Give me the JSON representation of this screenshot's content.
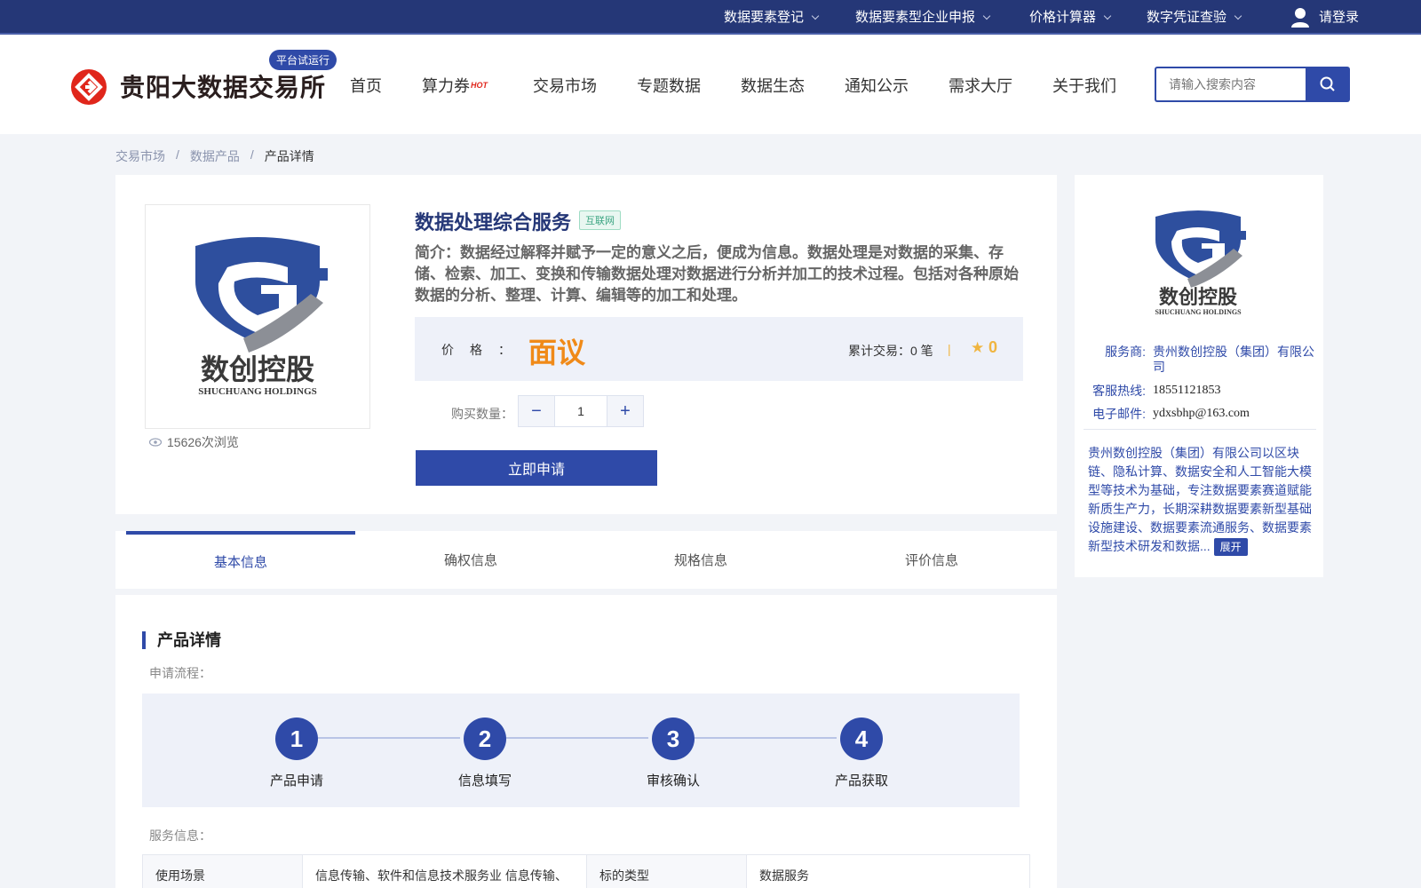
{
  "topbar": {
    "items": [
      "数据要素登记",
      "数据要素型企业申报",
      "价格计算器",
      "数字凭证查验"
    ],
    "login_label": "请登录"
  },
  "header": {
    "logo_text": "贵阳大数据交易所",
    "trial_badge": "平台试运行",
    "nav": [
      "首页",
      "算力券",
      "交易市场",
      "专题数据",
      "数据生态",
      "通知公示",
      "需求大厅",
      "关于我们"
    ],
    "hot_label": "HOT",
    "search_placeholder": "请输入搜索内容"
  },
  "breadcrumb": {
    "items": [
      "交易市场",
      "数据产品",
      "产品详情"
    ],
    "separator": "/"
  },
  "product": {
    "title": "数据处理综合服务",
    "tag": "互联网",
    "intro": "简介：数据经过解释并赋予一定的意义之后，便成为信息。数据处理是对数据的采集、存储、检索、加工、变换和传输数据处理对数据进行分析并加工的技术过程。包括对各种原始数据的分析、整理、计算、编辑等的加工和处理。",
    "logo_cn": "数创控股",
    "logo_en": "SHUCHUANG HOLDINGS",
    "views": "15626次浏览",
    "price_label": "价格：",
    "price_value": "面议",
    "trade_text": "累计交易：0 笔",
    "separator": "|",
    "score": "0",
    "qty_label": "购买数量：",
    "qty_value": "1",
    "minus": "−",
    "plus": "+",
    "apply_label": "立即申请"
  },
  "tabs": [
    "基本信息",
    "确权信息",
    "规格信息",
    "评价信息"
  ],
  "active_tab": 0,
  "detail": {
    "section_title": "产品详情",
    "process_label": "申请流程：",
    "steps": [
      {
        "num": "1",
        "label": "产品申请"
      },
      {
        "num": "2",
        "label": "信息填写"
      },
      {
        "num": "3",
        "label": "审核确认"
      },
      {
        "num": "4",
        "label": "产品获取"
      }
    ],
    "service_label": "服务信息：",
    "table": [
      {
        "k1": "使用场景",
        "v1": "信息传输、软件和信息技术服务业 信息传输、",
        "k2": "标的类型",
        "v2": "数据服务"
      }
    ]
  },
  "provider": {
    "logo_cn": "数创控股",
    "logo_en": "SHUCHUANG HOLDINGS",
    "provider_label": "服务商:",
    "provider_name": "贵州数创控股（集团）有限公司",
    "hotline_label": "客服热线:",
    "hotline": "18551121853",
    "email_label": "电子邮件:",
    "email": "ydxsbhp@163.com",
    "description": "贵州数创控股（集团）有限公司以区块链、隐私计算、数据安全和人工智能大模型等技术为基础，专注数据要素赛道赋能新质生产力，长期深耕数据要素新型基础设施建设、数据要素流通服务、数据要素新型技术研发和数据...",
    "expand_label": "展开"
  },
  "colors": {
    "primary": "#2f4aa8",
    "topbar": "#253777",
    "price": "#f08a18",
    "star": "#f0b540",
    "logo_red": "#e0261b"
  }
}
